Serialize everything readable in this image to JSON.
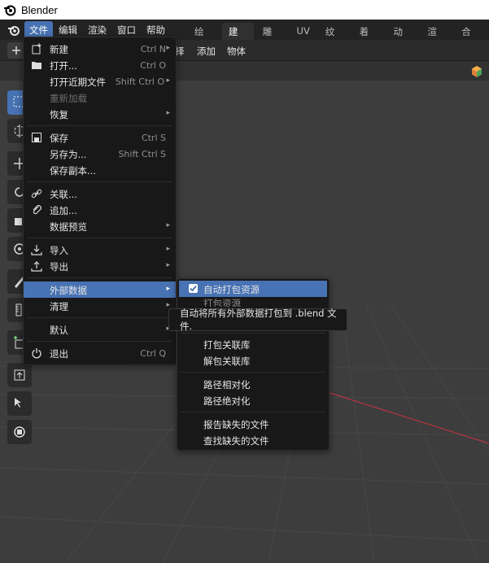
{
  "window": {
    "title": "Blender"
  },
  "menubar": [
    "文件",
    "编辑",
    "渲染",
    "窗口",
    "帮助"
  ],
  "workspace_tabs": [
    "绘画",
    "建模",
    "雕刻",
    "UV",
    "纹理",
    "着色",
    "动画",
    "渲染",
    "合成"
  ],
  "header": {
    "select_partial": "择",
    "add": "添加",
    "object": "物体"
  },
  "file_menu": {
    "new": {
      "label": "新建",
      "shortcut": "Ctrl N"
    },
    "open": {
      "label": "打开...",
      "shortcut": "Ctrl O"
    },
    "open_recent": {
      "label": "打开近期文件",
      "shortcut": "Shift Ctrl O"
    },
    "revert": {
      "label": "重新加载"
    },
    "recover": {
      "label": "恢复"
    },
    "save": {
      "label": "保存",
      "shortcut": "Ctrl S"
    },
    "save_as": {
      "label": "另存为...",
      "shortcut": "Shift Ctrl S"
    },
    "save_copy": {
      "label": "保存副本..."
    },
    "link": {
      "label": "关联..."
    },
    "append": {
      "label": "追加..."
    },
    "data_previews": {
      "label": "数据预览"
    },
    "import": {
      "label": "导入"
    },
    "export": {
      "label": "导出"
    },
    "external_data": {
      "label": "外部数据"
    },
    "clean_up": {
      "label": "清理"
    },
    "defaults": {
      "label": "默认"
    },
    "quit": {
      "label": "退出",
      "shortcut": "Ctrl Q"
    }
  },
  "external_data_menu": {
    "auto_pack": {
      "label": "自动打包资源",
      "checked": true
    },
    "pack_resources_partial": "打包资源",
    "pack_libraries": "打包关联库",
    "unpack_libraries": "解包关联库",
    "make_relative": "路径相对化",
    "make_absolute": "路径绝对化",
    "report_missing": "报告缺失的文件",
    "find_missing": "查找缺失的文件"
  },
  "tooltip": "自动将所有外部数据打包到 .blend 文件.",
  "colors": {
    "accent": "#4772b3",
    "menu_bg": "#181818",
    "topbar_bg": "#232323",
    "viewport_bg": "#3d3d3d",
    "axis_x": "#b8343f"
  }
}
